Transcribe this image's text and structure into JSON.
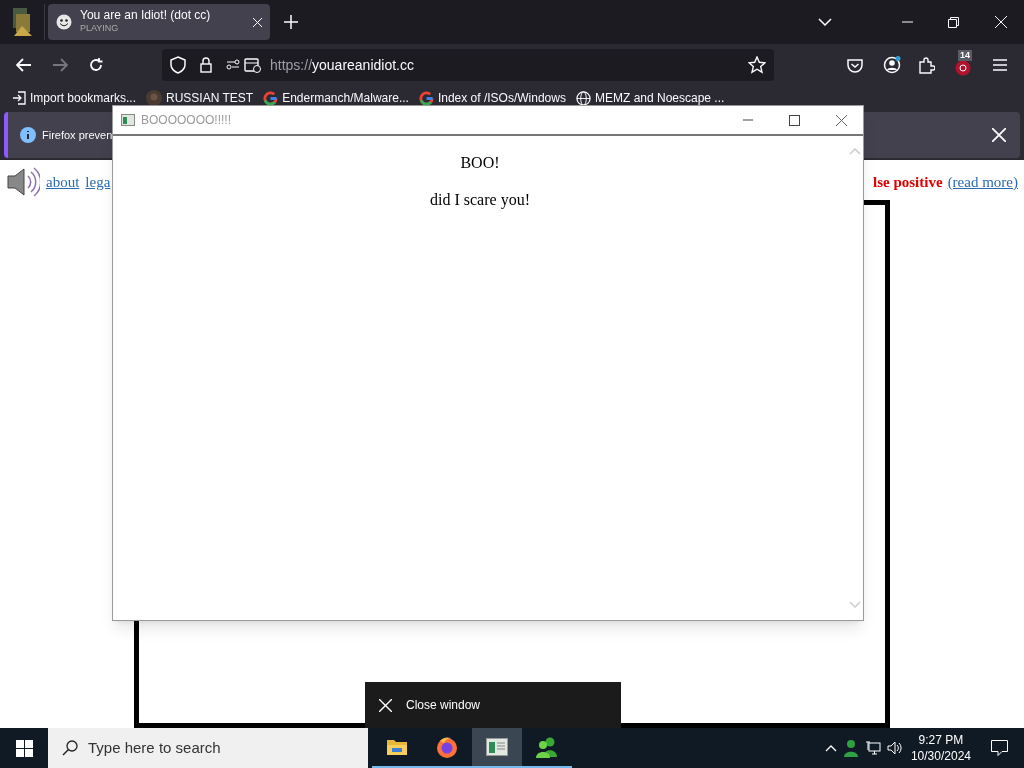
{
  "browser": {
    "tabs": [
      {
        "title": "You are an Idiot! (dot cc)",
        "subtitle": "PLAYING",
        "selected": true
      }
    ],
    "url": {
      "scheme": "https://",
      "host": "youareanidiot.cc"
    },
    "extension_badge": "14",
    "bookmarks": [
      {
        "kind": "import",
        "label": "Import bookmarks..."
      },
      {
        "kind": "avatar",
        "label": "RUSSIAN TEST"
      },
      {
        "kind": "google",
        "label": "Endermanch/Malware..."
      },
      {
        "kind": "google",
        "label": "Index of /ISOs/Windows"
      },
      {
        "kind": "globe",
        "label": "MEMZ and Noescape ..."
      }
    ],
    "notification": "Firefox preven"
  },
  "page": {
    "links": [
      "about",
      "lega"
    ],
    "warning": "lse positive",
    "read_more": "(read more)"
  },
  "popup": {
    "title": "BOOOOOOO!!!!!",
    "heading": "BOO!",
    "text": "did I scare you!"
  },
  "tooltip": "Close window",
  "taskbar": {
    "search_placeholder": "Type here to search",
    "apps": [
      {
        "kind": "folder",
        "selected": false
      },
      {
        "kind": "firefox",
        "selected": false
      },
      {
        "kind": "window",
        "selected": true
      },
      {
        "kind": "people",
        "selected": false
      }
    ],
    "time": "9:27 PM",
    "date": "10/30/2024"
  }
}
